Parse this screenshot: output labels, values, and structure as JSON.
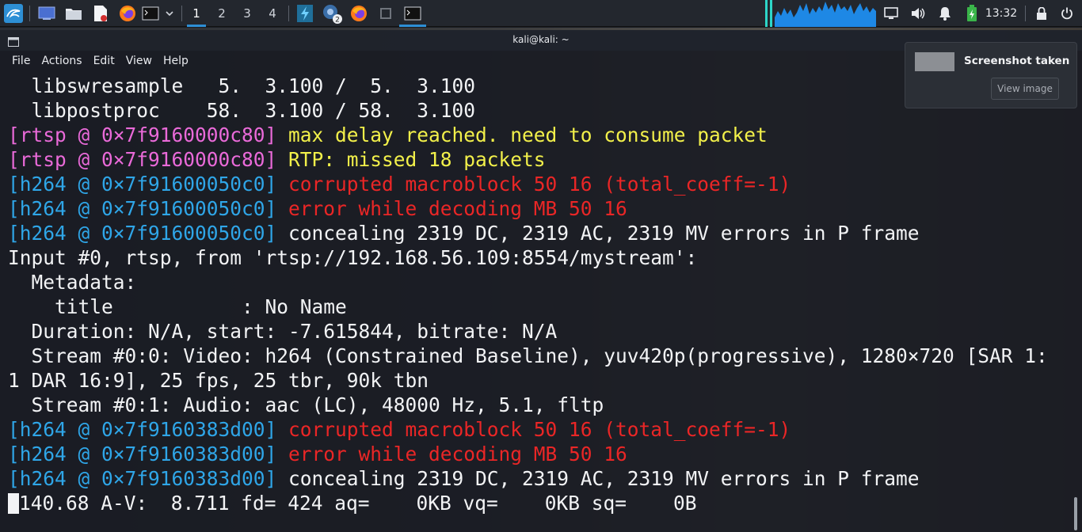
{
  "panel": {
    "workspaces": [
      "1",
      "2",
      "3",
      "4"
    ],
    "active_workspace": "1",
    "clock": "13:32",
    "notification_count_badge": "2",
    "icons": [
      "kali-menu-icon",
      "desktop-icon",
      "files-icon",
      "text-editor-icon",
      "firefox-icon",
      "terminal-icon",
      "chevron-down-icon"
    ]
  },
  "terminal": {
    "title": "kali@kali: ~",
    "menu": [
      "File",
      "Actions",
      "Edit",
      "View",
      "Help"
    ],
    "lines": [
      [
        {
          "t": "  libswresample   5.  3.100 /  5.  3.100",
          "c": "white"
        }
      ],
      [
        {
          "t": "  libpostproc    58.  3.100 / 58.  3.100",
          "c": "white"
        }
      ],
      [
        {
          "t": "[rtsp @ 0×7f9160000c80] ",
          "c": "magenta"
        },
        {
          "t": "max delay reached. need to consume packet",
          "c": "yellow"
        }
      ],
      [
        {
          "t": "[rtsp @ 0×7f9160000c80] ",
          "c": "magenta"
        },
        {
          "t": "RTP: missed 18 packets",
          "c": "yellow"
        }
      ],
      [
        {
          "t": "[h264 @ 0×7f91600050c0] ",
          "c": "cyan"
        },
        {
          "t": "corrupted macroblock 50 16 (total_coeff=-1)",
          "c": "red"
        }
      ],
      [
        {
          "t": "[h264 @ 0×7f91600050c0] ",
          "c": "cyan"
        },
        {
          "t": "error while decoding MB 50 16",
          "c": "red"
        }
      ],
      [
        {
          "t": "[h264 @ 0×7f91600050c0] ",
          "c": "cyan"
        },
        {
          "t": "concealing 2319 DC, 2319 AC, 2319 MV errors in P frame",
          "c": "white"
        }
      ],
      [
        {
          "t": "Input #0, rtsp, from 'rtsp://192.168.56.109:8554/mystream':",
          "c": "white"
        }
      ],
      [
        {
          "t": "  Metadata:",
          "c": "white"
        }
      ],
      [
        {
          "t": "    title           : No Name",
          "c": "white"
        }
      ],
      [
        {
          "t": "  Duration: N/A, start: -7.615844, bitrate: N/A",
          "c": "white"
        }
      ],
      [
        {
          "t": "  Stream #0:0: Video: h264 (Constrained Baseline), yuv420p(progressive), 1280×720 [SAR 1:",
          "c": "white"
        }
      ],
      [
        {
          "t": "1 DAR 16:9], 25 fps, 25 tbr, 90k tbn",
          "c": "white"
        }
      ],
      [
        {
          "t": "  Stream #0:1: Audio: aac (LC), 48000 Hz, 5.1, fltp",
          "c": "white"
        }
      ],
      [
        {
          "t": "[h264 @ 0×7f9160383d00] ",
          "c": "cyan"
        },
        {
          "t": "corrupted macroblock 50 16 (total_coeff=-1)",
          "c": "red"
        }
      ],
      [
        {
          "t": "[h264 @ 0×7f9160383d00] ",
          "c": "cyan"
        },
        {
          "t": "error while decoding MB 50 16",
          "c": "red"
        }
      ],
      [
        {
          "t": "[h264 @ 0×7f9160383d00] ",
          "c": "cyan"
        },
        {
          "t": "concealing 2319 DC, 2319 AC, 2319 MV errors in P frame",
          "c": "white"
        }
      ]
    ],
    "status_line": "140.68 A-V:  8.711 fd= 424 aq=    0KB vq=    0KB sq=    0B"
  },
  "notification": {
    "title": "Screenshot taken",
    "button": "View image"
  },
  "colors": {
    "white": "#f2f3f5",
    "magenta": "#ea6ad9",
    "cyan": "#2fa6e8",
    "yellow": "#f2f04a",
    "red": "#ea2626",
    "accent": "#2d8fd5"
  }
}
